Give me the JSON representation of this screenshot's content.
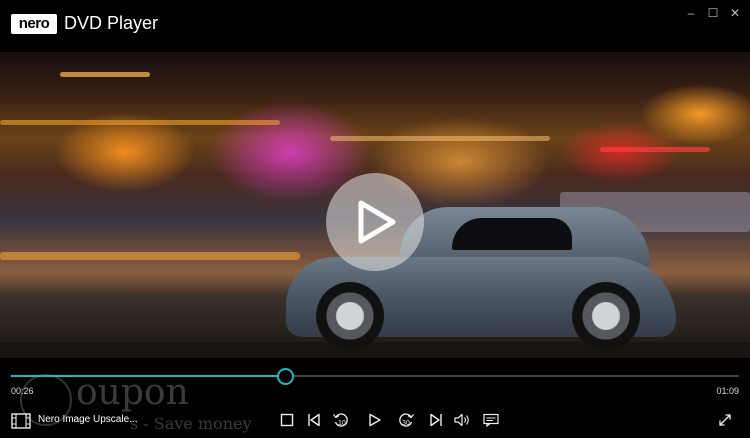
{
  "app": {
    "logo_text": "nero",
    "title": "DVD Player"
  },
  "window_controls": {
    "minimize": "–",
    "maximize": "☐",
    "close": "✕"
  },
  "player": {
    "current_time": "00:26",
    "total_time": "01:09",
    "progress": 0.377,
    "skip_back_seconds": "10",
    "skip_forward_seconds": "30"
  },
  "upscale": {
    "label": "Nero Image Upscale..."
  },
  "watermark": {
    "brand": "oupon",
    "tagline": "s - Save money"
  },
  "colors": {
    "accent": "#21b8c6",
    "background": "#000000"
  }
}
